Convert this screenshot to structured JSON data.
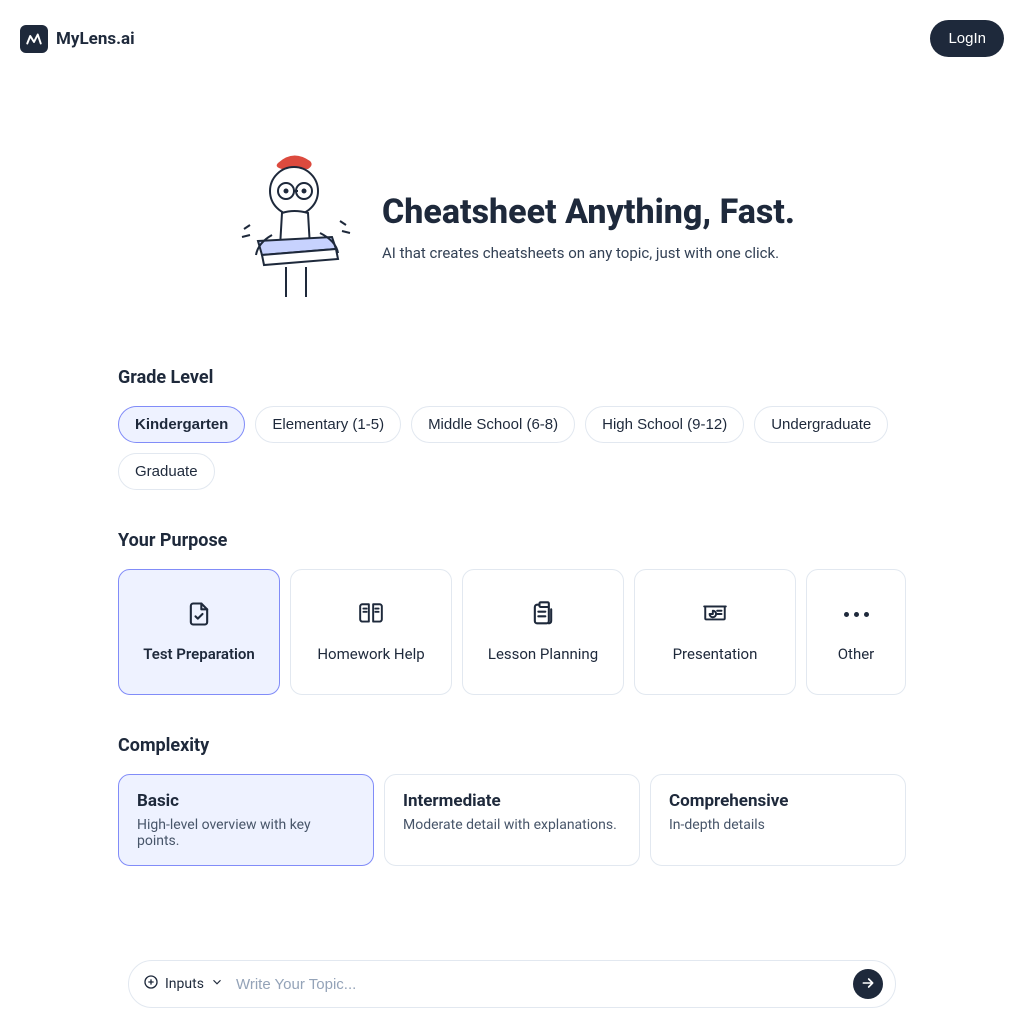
{
  "brand": {
    "name": "MyLens.ai"
  },
  "header": {
    "login_label": "LogIn"
  },
  "hero": {
    "title": "Cheatsheet Anything, Fast.",
    "subtitle": "AI that creates cheatsheets on any topic, just with one click."
  },
  "grade": {
    "title": "Grade Level",
    "options": [
      "Kindergarten",
      "Elementary (1-5)",
      "Middle School (6-8)",
      "High School (9-12)",
      "Undergraduate",
      "Graduate"
    ],
    "selected_index": 0
  },
  "purpose": {
    "title": "Your Purpose",
    "options": [
      {
        "label": "Test Preparation",
        "icon": "doc-check"
      },
      {
        "label": "Homework Help",
        "icon": "book-open"
      },
      {
        "label": "Lesson Planning",
        "icon": "clipboard"
      },
      {
        "label": "Presentation",
        "icon": "presentation"
      },
      {
        "label": "Other",
        "icon": "dots"
      }
    ],
    "selected_index": 0
  },
  "complexity": {
    "title": "Complexity",
    "options": [
      {
        "title": "Basic",
        "desc": "High-level overview with key points."
      },
      {
        "title": "Intermediate",
        "desc": "Moderate detail with explanations."
      },
      {
        "title": "Comprehensive",
        "desc": "In-depth details"
      }
    ],
    "selected_index": 0
  },
  "inputbar": {
    "inputs_label": "Inputs",
    "placeholder": "Write Your Topic..."
  }
}
